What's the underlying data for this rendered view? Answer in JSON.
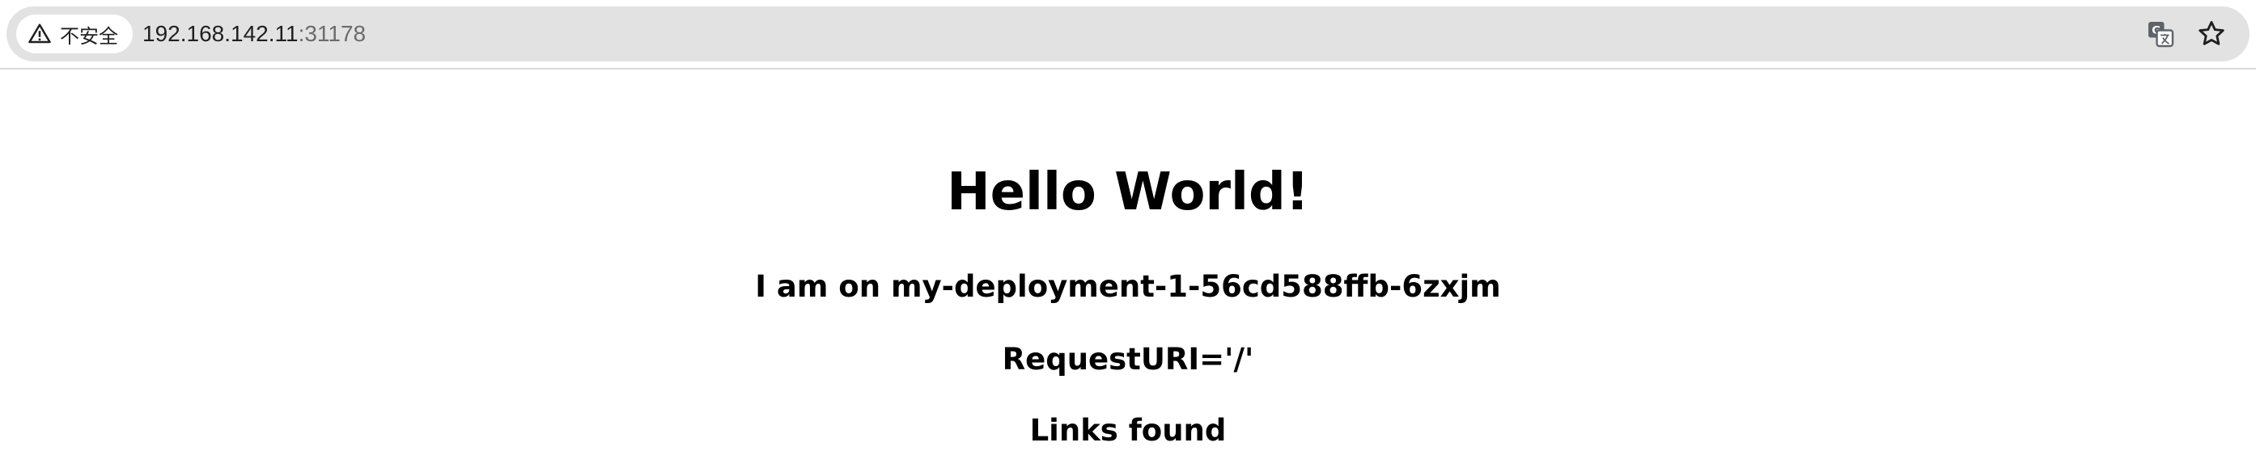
{
  "address_bar": {
    "security_label": "不安全",
    "url_host": "192.168.142.11",
    "url_separator": ":",
    "url_port": "31178"
  },
  "icons": {
    "security": "warning-triangle-icon",
    "translate": "translate-icon",
    "bookmark": "star-icon"
  },
  "content": {
    "heading": "Hello World!",
    "pod_line": "I am on my-deployment-1-56cd588ffb-6zxjm",
    "request_uri_line": "RequestURI='/'",
    "links_line": "Links found"
  },
  "colors": {
    "omnibox_background": "#e2e2e2",
    "page_background": "#ffffff",
    "text": "#000000",
    "url_secondary": "#6b6b6b"
  }
}
